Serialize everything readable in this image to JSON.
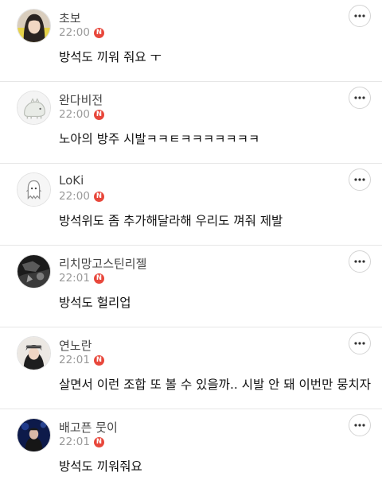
{
  "comments": [
    {
      "nickname": "초보",
      "time": "22:00",
      "badge": "N",
      "body": "방석도 끼워 줘요 ㅜ",
      "avatar_icon": "profile-photo",
      "more_icon": "more-icon"
    },
    {
      "nickname": "완다비전",
      "time": "22:00",
      "badge": "N",
      "body": "노아의 방주 시발ㅋㅋㅌㅋㅋㅋㅋㅋㅋㅋ",
      "avatar_icon": "cartoon-creature-avatar",
      "more_icon": "more-icon"
    },
    {
      "nickname": "LoKi",
      "time": "22:00",
      "badge": "N",
      "body": "방석위도 좀 추가해달라해 우리도 껴줘 제발",
      "avatar_icon": "ghost-avatar",
      "more_icon": "more-icon"
    },
    {
      "nickname": "리치망고스틴리젤",
      "time": "22:01",
      "badge": "N",
      "body": "방석도 헐리업",
      "avatar_icon": "profile-photo",
      "more_icon": "more-icon"
    },
    {
      "nickname": "연노란",
      "time": "22:01",
      "badge": "N",
      "body": "살면서 이런 조합 또 볼 수 있을까.. 시발 안 돼 이번만 뭉치자",
      "avatar_icon": "profile-photo",
      "more_icon": "more-icon"
    },
    {
      "nickname": "배고픈 뭇이",
      "time": "22:01",
      "badge": "N",
      "body": "방석도 끼워줘요",
      "avatar_icon": "profile-photo",
      "more_icon": "more-icon"
    }
  ],
  "colors": {
    "badge": "#e8473b",
    "time": "#9a9a9a",
    "divider": "#e6e6e6"
  }
}
